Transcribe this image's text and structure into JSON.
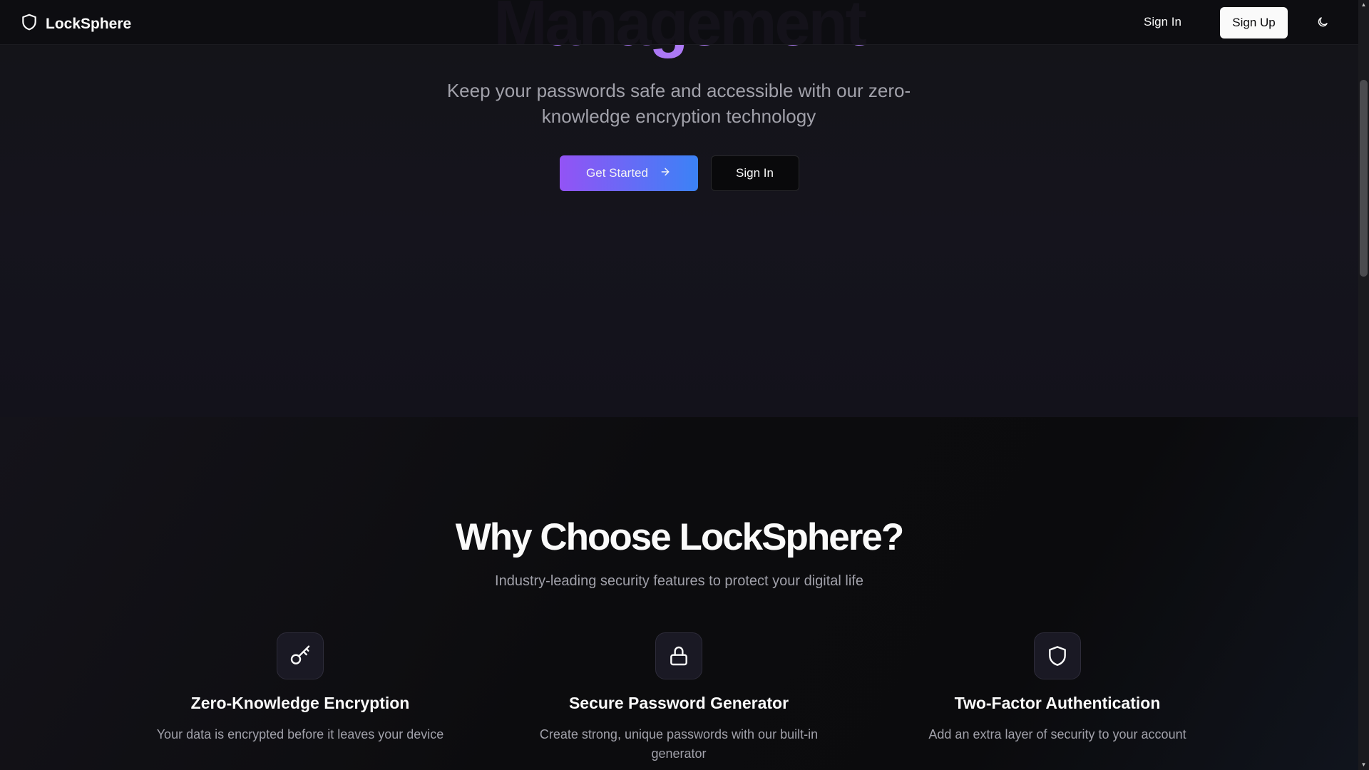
{
  "nav": {
    "brand": "LockSphere",
    "brand_icon": "shield-icon",
    "sign_in": "Sign In",
    "sign_up": "Sign Up",
    "theme_icon": "moon-icon"
  },
  "hero": {
    "title": "Management",
    "subtitle": "Keep your passwords safe and accessible with our zero-knowledge encryption technology",
    "primary_cta": "Get Started",
    "primary_cta_icon": "arrow-right-icon",
    "secondary_cta": "Sign In"
  },
  "features": {
    "title": "Why Choose LockSphere?",
    "subtitle": "Industry-leading security features to protect your digital life",
    "items": [
      {
        "icon": "key-icon",
        "title": "Zero-Knowledge Encryption",
        "description": "Your data is encrypted before it leaves your device"
      },
      {
        "icon": "lock-icon",
        "title": "Secure Password Generator",
        "description": "Create strong, unique passwords with our built-in generator"
      },
      {
        "icon": "shield-icon",
        "title": "Two-Factor Authentication",
        "description": "Add an extra layer of security to your account"
      }
    ]
  },
  "colors": {
    "gradient_start": "#9353f5",
    "gradient_end": "#3b82f6",
    "background": "#0a0a0c",
    "muted_text": "#a1a1aa"
  }
}
